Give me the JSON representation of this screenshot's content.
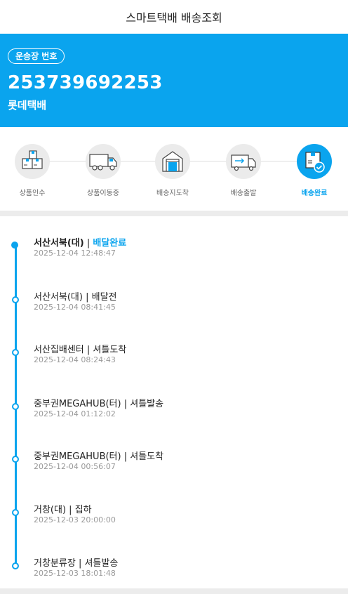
{
  "header": {
    "title": "스마트택배 배송조회"
  },
  "hero": {
    "badge": "운송장 번호",
    "tracking_number": "253739692253",
    "courier": "롯데택배"
  },
  "steps": [
    {
      "label": "상품인수",
      "icon": "boxes-icon",
      "active": false
    },
    {
      "label": "상품이동중",
      "icon": "truck-icon",
      "active": false
    },
    {
      "label": "배송지도착",
      "icon": "warehouse-icon",
      "active": false
    },
    {
      "label": "배송출발",
      "icon": "delivery-van-icon",
      "active": false
    },
    {
      "label": "배송완료",
      "icon": "box-check-icon",
      "active": true
    }
  ],
  "events": [
    {
      "location": "서산서북(대)",
      "sep": " | ",
      "status": "배달완료",
      "time": "2025-12-04 12:48:47",
      "highlight": true
    },
    {
      "location": "서산서북(대)",
      "sep": " | ",
      "status": "배달전",
      "time": "2025-12-04 08:41:45",
      "highlight": false
    },
    {
      "location": "서산집배센터",
      "sep": " | ",
      "status": "셔틀도착",
      "time": "2025-12-04 08:24:43",
      "highlight": false
    },
    {
      "location": "중부권MEGAHUB(터)",
      "sep": " | ",
      "status": "셔틀발송",
      "time": "2025-12-04 01:12:02",
      "highlight": false
    },
    {
      "location": "중부권MEGAHUB(터)",
      "sep": " | ",
      "status": "셔틀도착",
      "time": "2025-12-04 00:56:07",
      "highlight": false
    },
    {
      "location": "거창(대)",
      "sep": " | ",
      "status": "집하",
      "time": "2025-12-03 20:00:00",
      "highlight": false
    },
    {
      "location": "거창분류장",
      "sep": " | ",
      "status": "셔틀발송",
      "time": "2025-12-03 18:01:48",
      "highlight": false
    }
  ],
  "colors": {
    "accent": "#0aa4ee",
    "muted": "#999999"
  }
}
